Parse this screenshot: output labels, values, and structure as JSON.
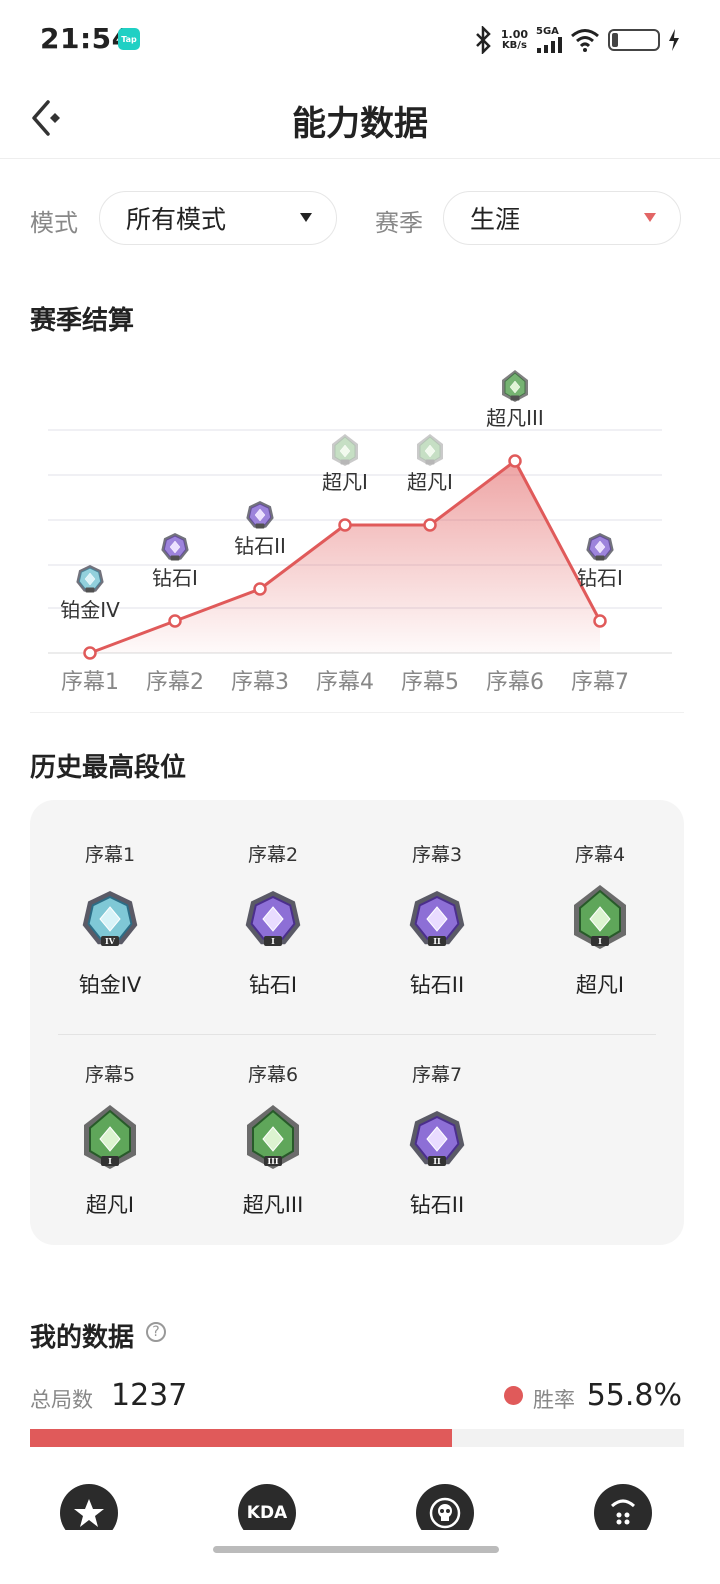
{
  "status_bar": {
    "time": "21:54",
    "app_badge": "Tap",
    "net_speed_value": "1.00",
    "net_speed_unit": "KB/s",
    "network": "5GA"
  },
  "header": {
    "title": "能力数据"
  },
  "filters": {
    "mode_label": "模式",
    "mode_value": "所有模式",
    "season_label": "赛季",
    "season_value": "生涯"
  },
  "season_summary": {
    "title": "赛季结算"
  },
  "chart_data": {
    "type": "area",
    "x": [
      "序幕1",
      "序幕2",
      "序幕3",
      "序幕4",
      "序幕5",
      "序幕6",
      "序幕7"
    ],
    "point_labels": [
      "铂金IV",
      "钻石I",
      "钻石II",
      "超凡I",
      "超凡I",
      "超凡III",
      "钻石I"
    ],
    "y_rank_index": [
      0,
      1,
      2,
      4,
      4,
      6,
      1
    ],
    "ylim": [
      0,
      7
    ],
    "color": "#e05a5a",
    "grid": true
  },
  "history": {
    "title": "历史最高段位",
    "items": [
      {
        "season": "序幕1",
        "rank": "铂金IV",
        "tier": "platinum",
        "numeral": "IV"
      },
      {
        "season": "序幕2",
        "rank": "钻石I",
        "tier": "diamond",
        "numeral": "I"
      },
      {
        "season": "序幕3",
        "rank": "钻石II",
        "tier": "diamond",
        "numeral": "II"
      },
      {
        "season": "序幕4",
        "rank": "超凡I",
        "tier": "ascendant",
        "numeral": "I"
      },
      {
        "season": "序幕5",
        "rank": "超凡I",
        "tier": "ascendant",
        "numeral": "I"
      },
      {
        "season": "序幕6",
        "rank": "超凡III",
        "tier": "ascendant",
        "numeral": "III"
      },
      {
        "season": "序幕7",
        "rank": "钻石II",
        "tier": "diamond",
        "numeral": "II"
      }
    ]
  },
  "my_data": {
    "title": "我的数据",
    "help_icon": "?",
    "total_label": "总局数",
    "total_value": "1237",
    "winrate_label": "胜率",
    "winrate_value": "55.8%",
    "winrate_fraction": 0.558,
    "winrate_color": "#e05a5a"
  },
  "bottom_nav": {
    "items": [
      {
        "icon": "star-badge-icon"
      },
      {
        "icon": "kda-icon",
        "label": "KDA"
      },
      {
        "icon": "skull-target-icon"
      },
      {
        "icon": "dice-icon"
      }
    ]
  }
}
